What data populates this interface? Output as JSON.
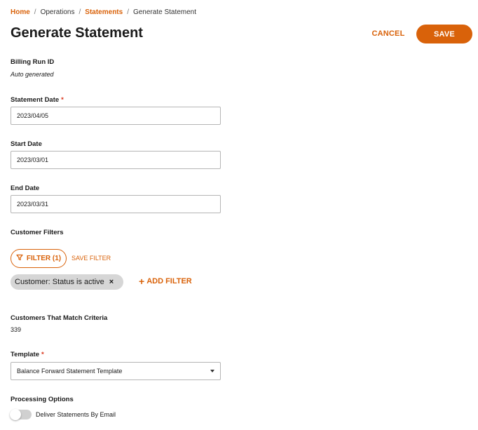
{
  "breadcrumb": {
    "items": [
      {
        "label": "Home",
        "link": true
      },
      {
        "label": "Operations",
        "link": false
      },
      {
        "label": "Statements",
        "link": true
      },
      {
        "label": "Generate Statement",
        "link": false
      }
    ],
    "separator": "/"
  },
  "page": {
    "title": "Generate Statement",
    "cancel_label": "CANCEL",
    "save_label": "SAVE"
  },
  "billing_run": {
    "label": "Billing Run ID",
    "value": "Auto generated"
  },
  "statement_date": {
    "label": "Statement Date",
    "required_mark": "*",
    "value": "2023/04/05"
  },
  "start_date": {
    "label": "Start Date",
    "value": "2023/03/01"
  },
  "end_date": {
    "label": "End Date",
    "value": "2023/03/31"
  },
  "customer_filters": {
    "label": "Customer Filters",
    "filter_button_label": "FILTER (1)",
    "save_filter_label": "SAVE FILTER",
    "chips": [
      {
        "label": "Customer: Status is active",
        "remove_glyph": "×"
      }
    ],
    "add_filter_label": "ADD FILTER",
    "add_filter_glyph": "+"
  },
  "match": {
    "label": "Customers That Match Criteria",
    "value": "339"
  },
  "template": {
    "label": "Template",
    "required_mark": "*",
    "selected": "Balance Forward Statement Template"
  },
  "processing": {
    "label": "Processing Options",
    "toggle_label": "Deliver Statements By Email",
    "toggle_on": false
  },
  "colors": {
    "accent": "#d9620a",
    "required": "#d9341a",
    "chip_bg": "#d6d6d6"
  },
  "icons": {
    "filter": "funnel-icon",
    "remove_chip": "close-icon",
    "add": "plus-icon",
    "dropdown": "caret-down-icon"
  }
}
